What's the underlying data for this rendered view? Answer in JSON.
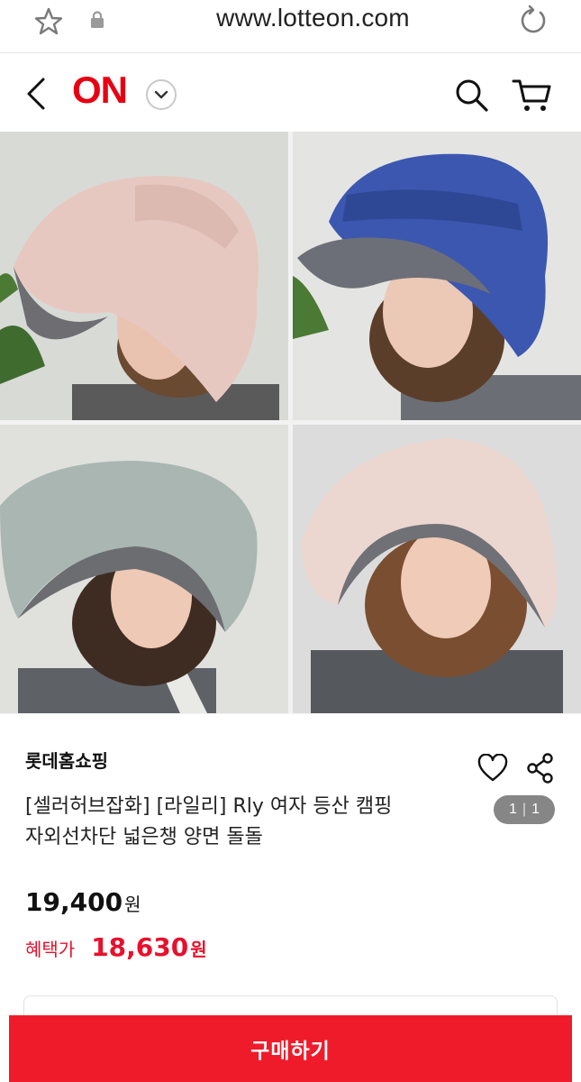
{
  "browser": {
    "url": "www.lotteon.com",
    "icons": [
      "star-icon",
      "lock-icon",
      "reload-icon"
    ]
  },
  "header": {
    "logo_text": "ON",
    "icons": [
      "back-icon",
      "chevron-down-icon",
      "search-icon",
      "cart-icon"
    ],
    "brand_color": "#e60012"
  },
  "gallery": {
    "image_count": 4,
    "hat_colors": [
      "#e9c9c2",
      "#3c57b0",
      "#a9b6b2",
      "#ecd6d0"
    ],
    "counter_current": "1",
    "counter_sep": "|",
    "counter_total": "1"
  },
  "product": {
    "seller": "롯데홈쇼핑",
    "title_line1": "[셀러허브잡화] [라일리] Rly 여자 등산 캠핑",
    "title_line2": "자외선차단 넓은챙 양면 돌돌",
    "price": "19,400",
    "price_unit": "원",
    "benefit_label": "혜택가",
    "benefit_price": "18,630",
    "benefit_unit": "원",
    "accent_color": "#e8102b"
  },
  "actions": {
    "buy_label": "구매하기"
  }
}
